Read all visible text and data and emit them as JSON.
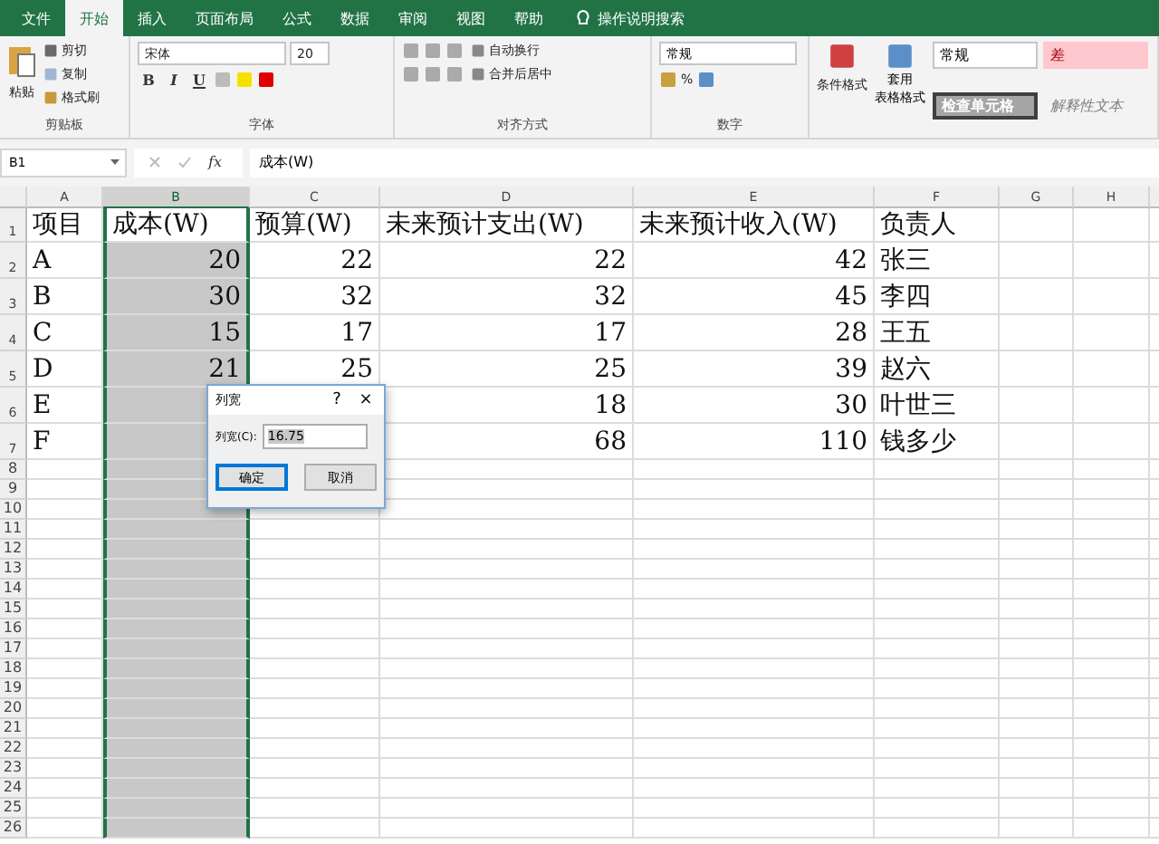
{
  "tabs": [
    {
      "label": "文件",
      "selected": false
    },
    {
      "label": "开始",
      "selected": true
    },
    {
      "label": "插入",
      "selected": false
    },
    {
      "label": "页面布局",
      "selected": false
    },
    {
      "label": "公式",
      "selected": false
    },
    {
      "label": "数据",
      "selected": false
    },
    {
      "label": "审阅",
      "selected": false
    },
    {
      "label": "视图",
      "selected": false
    },
    {
      "label": "帮助",
      "selected": false
    }
  ],
  "tell_me": {
    "placeholder": "操作说明搜索"
  },
  "ribbon": {
    "clipboard": {
      "label": "剪贴板",
      "paste": "粘贴",
      "cut": "剪切",
      "copy": "复制",
      "format_painter": "格式刷"
    },
    "font": {
      "label": "字体",
      "font_name": "宋体",
      "font_size": "20",
      "bold": "B",
      "italic": "I",
      "underline": "U"
    },
    "alignment": {
      "label": "对齐方式",
      "wrap": "自动换行",
      "merge": "合并后居中"
    },
    "number": {
      "label": "数字",
      "format": "常规",
      "percent": "%"
    },
    "styles": {
      "conditional": "条件格式",
      "table_format": [
        "套用",
        "表格格式"
      ],
      "cell_styles": [
        {
          "label": "常规",
          "kind": "normal"
        },
        {
          "label": "差",
          "kind": "bad"
        },
        {
          "label": "检查单元格",
          "kind": "check"
        },
        {
          "label": "解释性文本",
          "kind": "explanatory"
        }
      ]
    }
  },
  "formula_bar": {
    "name_box": "B1",
    "function_label": "fx",
    "value": "成本(W)"
  },
  "columns": [
    {
      "letter": "A",
      "selected": false
    },
    {
      "letter": "B",
      "selected": true
    },
    {
      "letter": "C",
      "selected": false
    },
    {
      "letter": "D",
      "selected": false
    },
    {
      "letter": "E",
      "selected": false
    },
    {
      "letter": "F",
      "selected": false
    },
    {
      "letter": "G",
      "selected": false
    },
    {
      "letter": "H",
      "selected": false
    }
  ],
  "rows": [
    {
      "number": "1",
      "cells": [
        "项目",
        "成本(W)",
        "预算(W)",
        "未来预计支出(W)",
        "未来预计收入(W)",
        "负责人"
      ]
    },
    {
      "number": "2",
      "cells": [
        "A",
        "20",
        "22",
        "22",
        "42",
        "张三"
      ]
    },
    {
      "number": "3",
      "cells": [
        "B",
        "30",
        "32",
        "32",
        "45",
        "李四"
      ]
    },
    {
      "number": "4",
      "cells": [
        "C",
        "15",
        "17",
        "17",
        "28",
        "王五"
      ]
    },
    {
      "number": "5",
      "cells": [
        "D",
        "21",
        "25",
        "25",
        "39",
        "赵六"
      ]
    },
    {
      "number": "6",
      "cells": [
        "E",
        "",
        "",
        "18",
        "30",
        "叶世三"
      ]
    },
    {
      "number": "7",
      "cells": [
        "F",
        "",
        "",
        "68",
        "110",
        "钱多少"
      ]
    },
    {
      "number": "8"
    },
    {
      "number": "9"
    },
    {
      "number": "10"
    },
    {
      "number": "11"
    },
    {
      "number": "12"
    },
    {
      "number": "13"
    },
    {
      "number": "14"
    },
    {
      "number": "15"
    },
    {
      "number": "16"
    },
    {
      "number": "17"
    },
    {
      "number": "18"
    },
    {
      "number": "19"
    },
    {
      "number": "20"
    },
    {
      "number": "21"
    },
    {
      "number": "22"
    },
    {
      "number": "23"
    },
    {
      "number": "24"
    },
    {
      "number": "25"
    },
    {
      "number": "26"
    }
  ],
  "dialog": {
    "title": "列宽",
    "help": "?",
    "close": "×",
    "field_label": "列宽(C):",
    "value": "16.75",
    "buttons": [
      {
        "label": "确定",
        "default": true
      },
      {
        "label": "取消",
        "default": false
      }
    ]
  }
}
